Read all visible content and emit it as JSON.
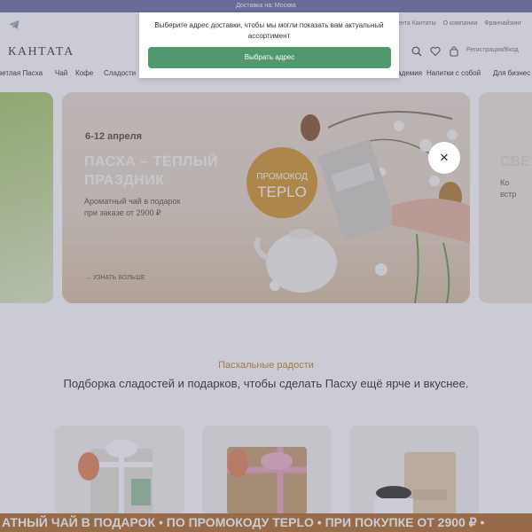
{
  "topbar": {
    "text": "Доставка на: Москва"
  },
  "header": {
    "logo": "КАНТАТА",
    "links": [
      "ента Кантаты",
      "О компании",
      "Франчайзинг"
    ],
    "login": "Регистрация/Вход",
    "icons": [
      "telegram-icon",
      "search-icon",
      "heart-icon",
      "bag-icon"
    ]
  },
  "nav": {
    "items": [
      "ветлая Пасха",
      "Чай",
      "Кофе",
      "Сладости",
      "академия",
      "Напитки с собой",
      "Для бизнес"
    ]
  },
  "popup": {
    "message": "Выберите адрес доставки, чтобы мы могли показать вам актуальный ассортимент",
    "button": "Выбрать адрес"
  },
  "banner": {
    "date": "6-12 апреля",
    "title_line1": "ПАСХА – ТЁПЛЫЙ",
    "title_line2": "ПРАЗДНИК",
    "subtitle_line1": "Ароматный чай в подарок",
    "subtitle_line2": "при заказе от 2900 ₽",
    "promo_label": "ПРОМОКОД",
    "promo_code": "TEPLO",
    "more": "→ УЗНАТЬ БОЛЬШЕ"
  },
  "side_banner_right": {
    "title": "СВЕ",
    "line1": "Ко",
    "line2": "встр"
  },
  "close_button": "×",
  "section": {
    "kicker": "Пасхальные радости",
    "title": "Подборка сладостей и подарков, чтобы сделать Пасху ещё ярче и вкуснее."
  },
  "ticker": {
    "text": "АТНЫЙ ЧАЙ В ПОДАРОК • ПО ПРОМОКОДУ TEPLO • ПРИ ПОКУПКЕ ОТ 2900 ₽ •"
  },
  "colors": {
    "accent_green": "#4e9a6e",
    "promo_gold": "#d49a33",
    "ticker_brown": "#b57232",
    "kicker_orange": "#c98a2b",
    "topbar_purple": "#6f73a8"
  }
}
